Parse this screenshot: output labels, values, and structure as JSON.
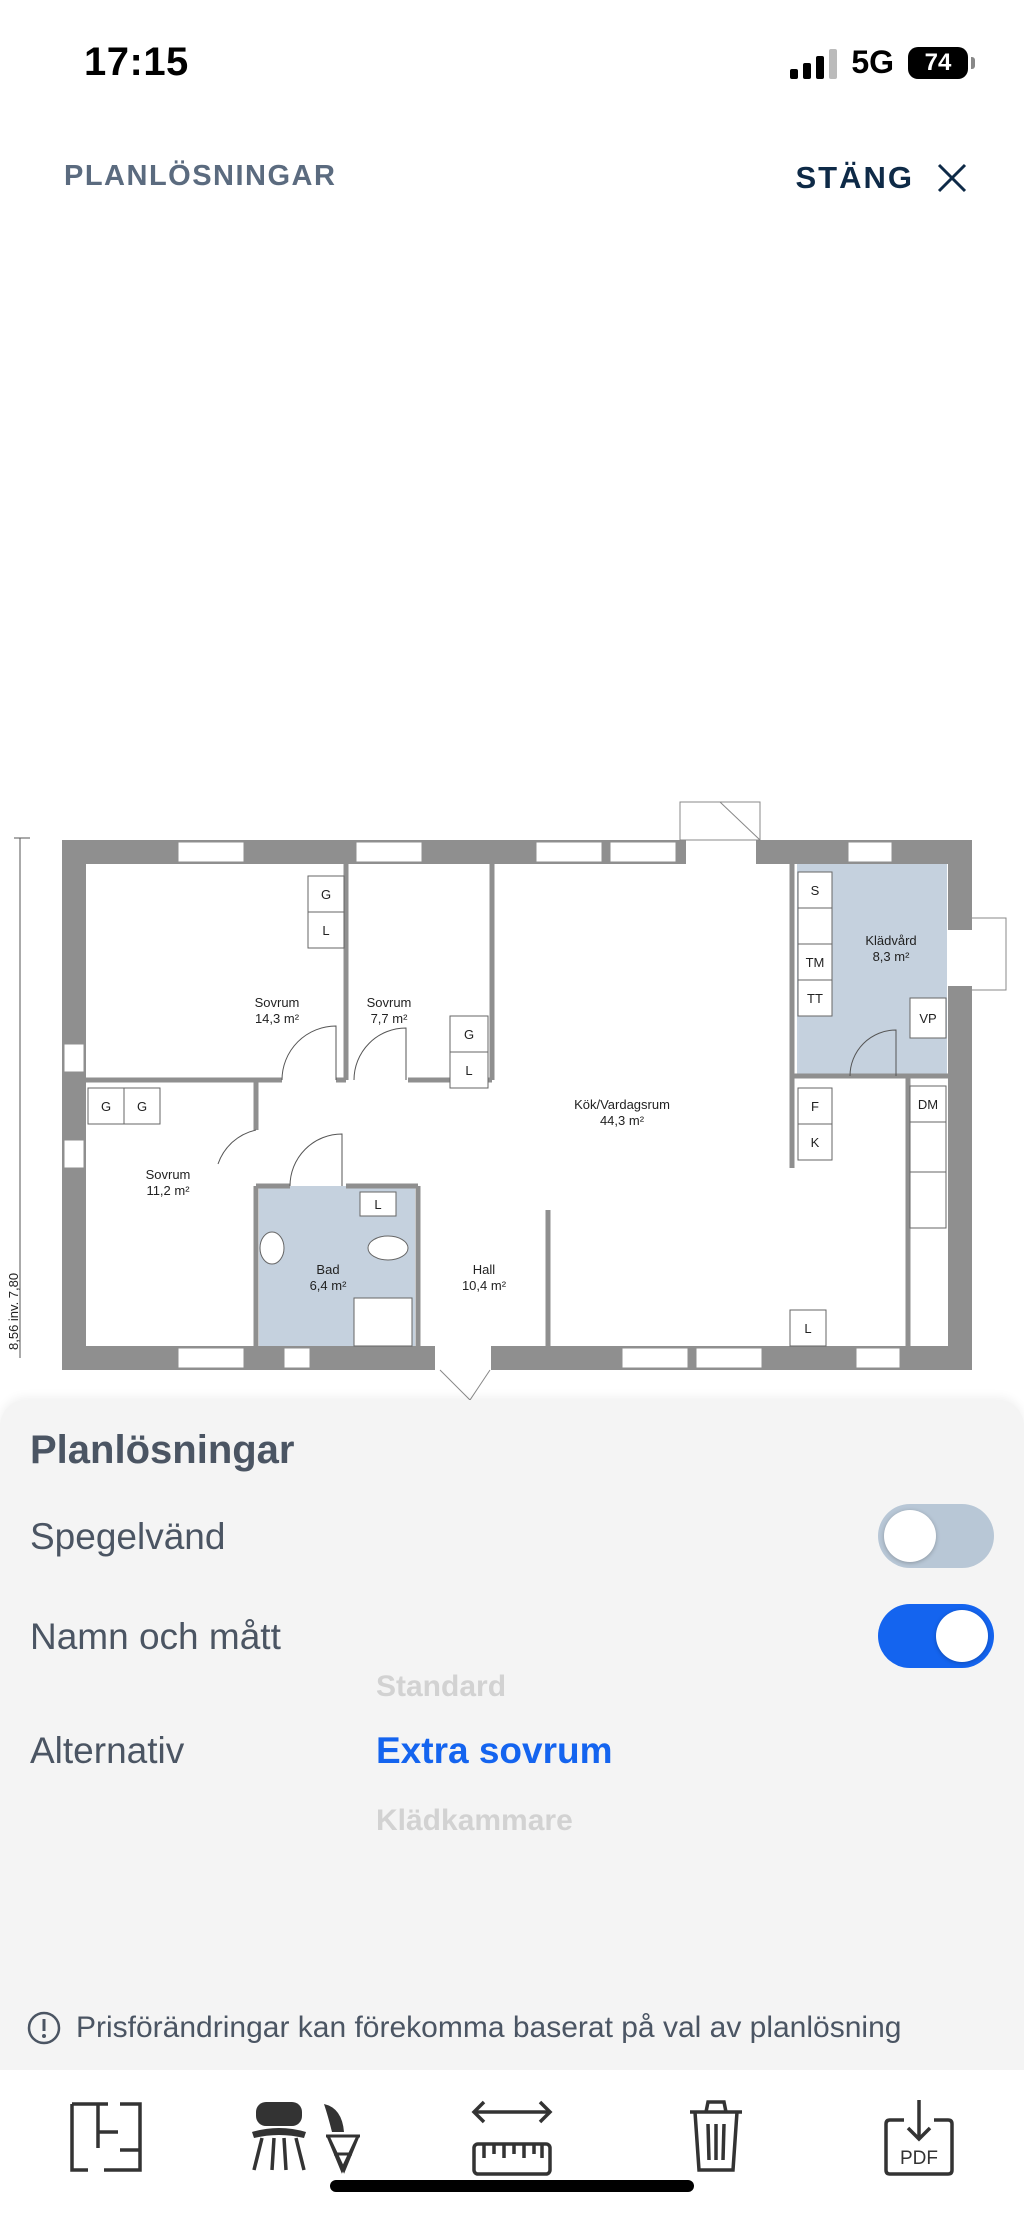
{
  "status": {
    "time": "17:15",
    "network": "5G",
    "battery": "74"
  },
  "header": {
    "title": "PLANLÖSNINGAR",
    "close_label": "STÄNG"
  },
  "floorplan": {
    "rooms": [
      {
        "name": "Sovrum",
        "area": "14,3 m²"
      },
      {
        "name": "Sovrum",
        "area": "7,7 m²"
      },
      {
        "name": "Sovrum",
        "area": "11,2 m²"
      },
      {
        "name": "Kök/Vardagsrum",
        "area": "44,3 m²"
      },
      {
        "name": "Klädvård",
        "area": "8,3 m²"
      },
      {
        "name": "Bad",
        "area": "6,4 m²"
      },
      {
        "name": "Hall",
        "area": "10,4 m²"
      }
    ],
    "fixtures": [
      "G",
      "L",
      "G",
      "L",
      "G",
      "G",
      "S",
      "TM",
      "TT",
      "VP",
      "F",
      "K",
      "DM",
      "L",
      "L"
    ],
    "dimension": "8,56 inv. 7,80",
    "colors": {
      "wall": "#8f8f8f",
      "wet_room": "#c5d1de"
    }
  },
  "sheet": {
    "title": "Planlösningar",
    "mirror_label": "Spegelvänd",
    "names_label": "Namn och mått",
    "alt_label": "Alternativ",
    "picker": {
      "prev": "Standard",
      "selected": "Extra sovrum",
      "next": "Klädkammare"
    },
    "info": "Prisförändringar kan förekomma baserat på val av planlösning"
  },
  "toolbar": {
    "pdf_label": "PDF"
  },
  "colors": {
    "accent": "#1464ef",
    "toggle_off": "#b8c7d6"
  }
}
